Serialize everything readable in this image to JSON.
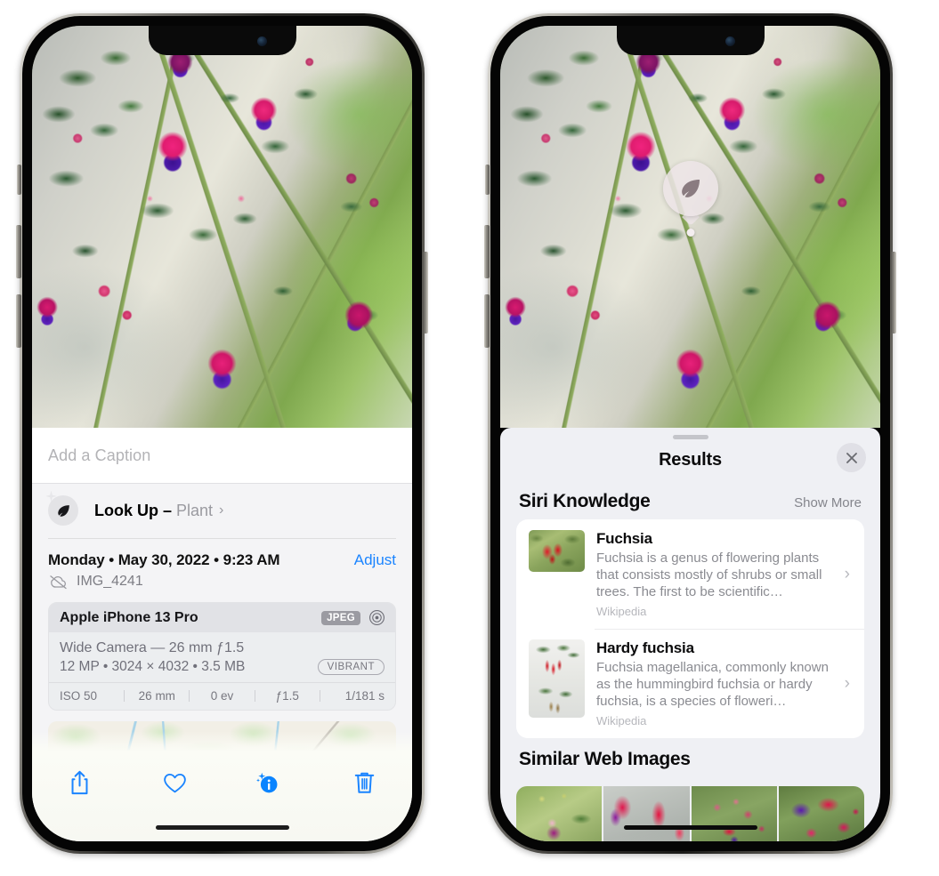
{
  "left_phone": {
    "caption": {
      "placeholder": "Add a Caption",
      "value": ""
    },
    "lookup": {
      "label": "Look Up –",
      "subject": "Plant",
      "chevron": "›",
      "icon": "leaf-icon"
    },
    "date": "Monday • May 30, 2022 • 9:23 AM",
    "adjust_label": "Adjust",
    "filename": "IMG_4241",
    "camera": {
      "model": "Apple iPhone 13 Pro",
      "format_badge": "JPEG",
      "lens_line": "Wide Camera — 26 mm ƒ1.5",
      "specs_line": "12 MP • 3024 × 4032 • 3.5 MB",
      "style_badge": "VIBRANT",
      "exif": [
        "ISO 50",
        "26 mm",
        "0 ev",
        "ƒ1.5",
        "1/181 s"
      ]
    },
    "toolbar": [
      {
        "name": "share-button",
        "icon": "share-icon"
      },
      {
        "name": "favorite-button",
        "icon": "heart-icon"
      },
      {
        "name": "info-button",
        "icon": "info-sparkle-icon"
      },
      {
        "name": "delete-button",
        "icon": "trash-icon"
      }
    ]
  },
  "right_phone": {
    "visual_lookup_badge": {
      "icon": "leaf-icon"
    },
    "sheet": {
      "title": "Results",
      "close_icon": "close-icon",
      "sections": [
        {
          "title": "Siri Knowledge",
          "action_label": "Show More",
          "items": [
            {
              "title": "Fuchsia",
              "description": "Fuchsia is a genus of flowering plants that consists mostly of shrubs or small trees. The first to be scientific…",
              "source": "Wikipedia",
              "chevron": "›"
            },
            {
              "title": "Hardy fuchsia",
              "description": "Fuchsia magellanica, commonly known as the hummingbird fuchsia or hardy fuchsia, is a species of floweri…",
              "source": "Wikipedia",
              "chevron": "›"
            }
          ]
        },
        {
          "title": "Similar Web Images",
          "items": [
            {
              "alt": "fuchsia-thumbnail-1"
            },
            {
              "alt": "fuchsia-thumbnail-2"
            },
            {
              "alt": "fuchsia-thumbnail-3"
            },
            {
              "alt": "fuchsia-thumbnail-4"
            }
          ]
        }
      ]
    }
  },
  "colors": {
    "accent_blue": "#1a84ff",
    "sheet_bg": "#eff0f4",
    "card_bg": "#ffffff",
    "secondary_text": "#8a8b91"
  }
}
